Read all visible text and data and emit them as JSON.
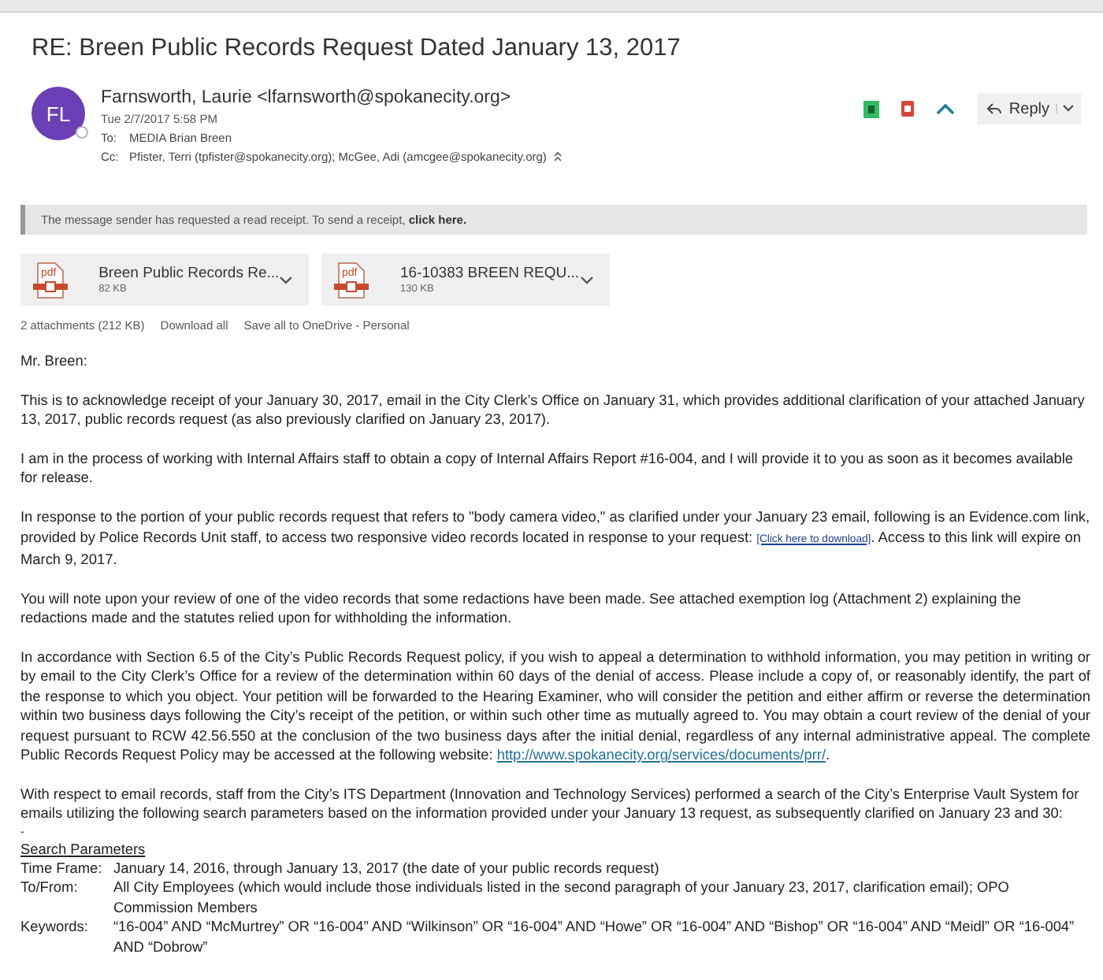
{
  "subject": "RE: Breen Public Records Request Dated January 13, 2017",
  "sender": {
    "initials": "FL",
    "name": "Farnsworth, Laurie <lfarnsworth@spokanecity.org>",
    "date": "Tue 2/7/2017 5:58 PM",
    "to_label": "To:",
    "to": "MEDIA Brian Breen",
    "cc_label": "Cc:",
    "cc": "Pfister, Terri (tpfister@spokanecity.org); McGee, Adi (amcgee@spokanecity.org)"
  },
  "reply_label": "Reply",
  "read_receipt": {
    "text": "The message sender has requested a read receipt. To send a receipt,",
    "link": "click here."
  },
  "attachments": [
    {
      "icon_label": "pdf",
      "name": "Breen Public Records Re...",
      "size": "82 KB"
    },
    {
      "icon_label": "pdf",
      "name": "16-10383 BREEN REQU...",
      "size": "130 KB"
    }
  ],
  "attachment_summary": "2 attachments (212 KB)",
  "attachment_actions": [
    "Download all",
    "Save all to OneDrive - Personal"
  ],
  "greeting": "Mr. Breen:",
  "paragraphs": [
    {
      "parts": [
        {
          "kind": "text",
          "text": "This is to acknowledge receipt of your January 30, 2017, email in the City Clerk’s Office on January 31, which provides additional clarification of your attached January 13, 2017, public records request (as also previously clarified on January 23, 2017)."
        }
      ]
    },
    {
      "parts": [
        {
          "kind": "text",
          "text": "I am in the process of working with Internal Affairs staff to obtain a copy of Internal Affairs Report #16-004, and I will provide it to you as soon as it becomes available for release."
        }
      ]
    },
    {
      "parts": [
        {
          "kind": "text",
          "text": "In response to the portion of your public records request that refers to \"body camera video,\" as clarified under your January 23 email, following is an Evidence.com link, provided by Police Records Unit staff, to access two responsive video records located in response to your request: "
        },
        {
          "kind": "small-link",
          "text": "[Click here to download]"
        },
        {
          "kind": "text",
          "text": ".   Access to this link will expire on March 9, 2017."
        }
      ]
    },
    {
      "parts": [
        {
          "kind": "text",
          "text": "You will note upon your review of one of the video records that some redactions have been made. See attached exemption log (Attachment 2) explaining the redactions made and the statutes relied upon for withholding the information."
        }
      ]
    },
    {
      "kind": "justified",
      "parts": [
        {
          "kind": "text",
          "text": "In accordance with Section 6.5 of the City’s Public Records Request policy, if you wish to appeal a determination to withhold information, you may petition in writing or by email to the City Clerk’s Office for a review of the determination within 60 days of the denial of access.  Please include a copy of, or reasonably identify, the part of the response to which you object.  Your petition will be forwarded to the Hearing Examiner, who will consider the petition and either affirm or reverse the determination within two business days following the City’s receipt of the petition, or within such other time as mutually agreed to.  You may obtain a court review of the denial of your request pursuant to RCW 42.56.550 at the conclusion of the two business days after the initial denial, regardless of any internal administrative appeal.  The complete Public Records Request Policy may be accessed at the following website:  "
        },
        {
          "kind": "link",
          "text": "http://www.spokanecity.org/services/documents/prr/"
        },
        {
          "kind": "text",
          "text": "."
        }
      ]
    },
    {
      "parts": [
        {
          "kind": "text",
          "text": "With respect to email records, staff from the City’s ITS Department (Innovation and Technology Services) performed a search of the City’s Enterprise Vault System for emails utilizing the following search parameters based on the information provided under your January 13 request, as subsequently clarified on January 23 and 30:"
        }
      ]
    }
  ],
  "stray_mark": "-",
  "search_parameters": {
    "heading": "Search Parameters",
    "rows": [
      {
        "label": "Time Frame:",
        "value": "January 14, 2016, through January 13, 2017 (the date of your public records request)"
      },
      {
        "label": "To/From:",
        "value": "All City Employees (which would include those individuals listed in the second paragraph of your January 23, 2017, clarification email); OPO Commission Members"
      },
      {
        "label": "Keywords:",
        "value": "“16-004” AND “McMurtrey” OR “16-004” AND “Wilkinson” OR “16-004” AND “Howe” OR “16-004” AND “Bishop” OR “16-004” AND “Meidl” OR “16-004” AND “Dobrow”"
      }
    ]
  }
}
